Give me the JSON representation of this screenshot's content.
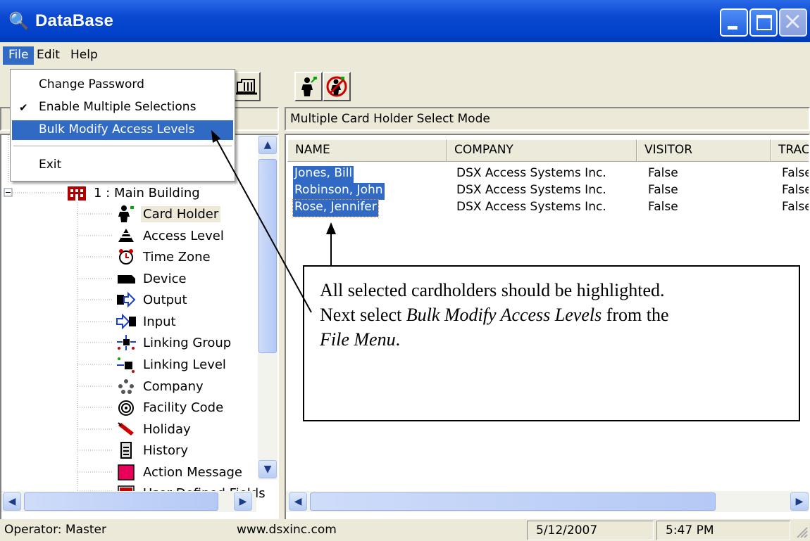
{
  "window": {
    "title": "DataBase"
  },
  "menubar": {
    "file": "File",
    "edit": "Edit",
    "help": "Help"
  },
  "file_menu": {
    "items": [
      "Change Password",
      "Enable Multiple Selections",
      "Bulk Modify Access Levels",
      "Exit"
    ],
    "checked_item": "Enable Multiple Selections",
    "highlighted_item": "Bulk Modify Access Levels"
  },
  "right_header": {
    "mode": "Multiple Card Holder Select Mode"
  },
  "tree": {
    "root": "1 : Main Building",
    "items": [
      "Card Holder",
      "Access Level",
      "Time Zone",
      "Device",
      "Output",
      "Input",
      "Linking Group",
      "Linking Level",
      "Company",
      "Facility Code",
      "Holiday",
      "History",
      "Action Message",
      "User Defined Fields"
    ],
    "selected": "Card Holder"
  },
  "list": {
    "columns": [
      "NAME",
      "COMPANY",
      "VISITOR",
      "TRACE"
    ],
    "rows": [
      {
        "name": "Jones, Bill",
        "company": "DSX Access Systems Inc.",
        "visitor": "False",
        "trace": "False"
      },
      {
        "name": "Robinson, John",
        "company": "DSX Access Systems Inc.",
        "visitor": "False",
        "trace": "False"
      },
      {
        "name": "Rose, Jennifer",
        "company": "DSX Access Systems Inc.",
        "visitor": "False",
        "trace": "False"
      }
    ]
  },
  "callout": {
    "line1": "All selected cardholders should be highlighted.",
    "line2_prefix": "Next select ",
    "line2_italic": "Bulk Modify Access Levels",
    "line2_suffix": " from the",
    "line3_italic": "File Menu",
    "line3_suffix": "."
  },
  "statusbar": {
    "operator": "Operator:  Master",
    "website": "www.dsxinc.com",
    "date": "5/12/2007",
    "time": "5:47 PM"
  },
  "colors": {
    "title_blue": "#0a48d0",
    "selection": "#316ac5",
    "chrome": "#ece9d8"
  }
}
